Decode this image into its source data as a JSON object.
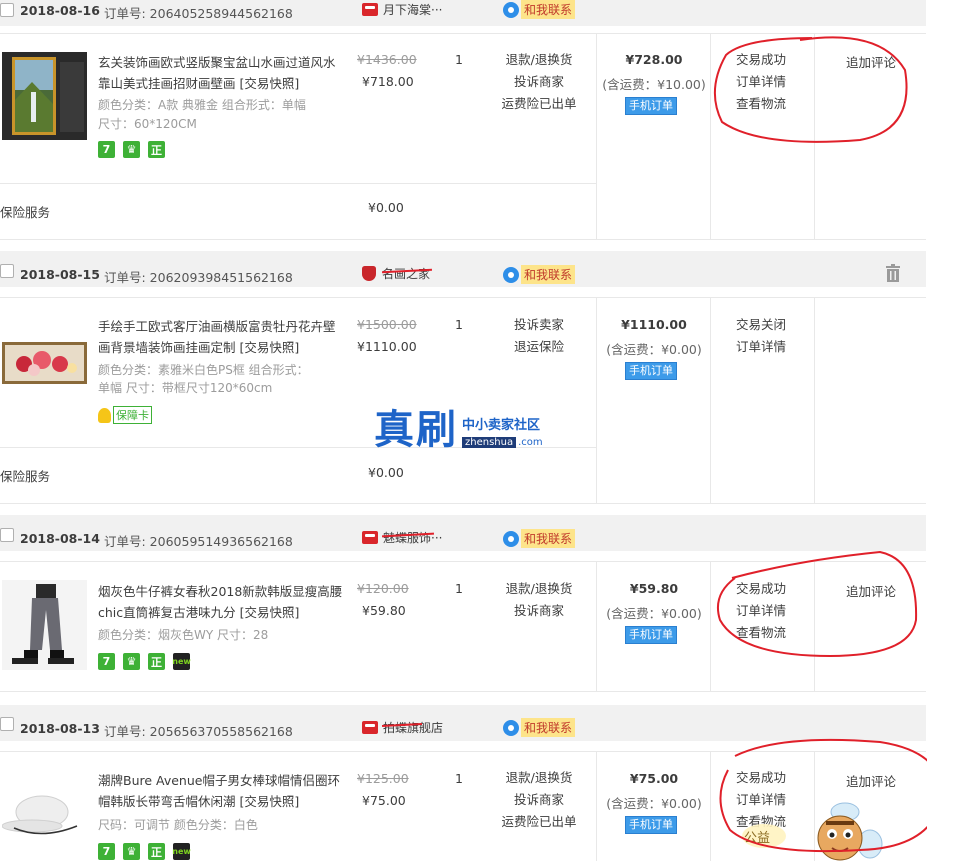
{
  "orders": [
    {
      "date": "2018-08-16",
      "order_label": "订单号: 206405258944562168",
      "shop": "月下海棠···",
      "contact": "和我联系",
      "title": "玄关装饰画欧式竖版聚宝盆山水画过道风水靠山美式挂画招财画壁画 [交易快照]",
      "sku_lines": [
        "颜色分类：A款 典雅金  组合形式：单幅",
        "尺寸：60*120CM"
      ],
      "orig_price": "¥1436.00",
      "price": "¥718.00",
      "qty": "1",
      "services": [
        "退款/退换货",
        "投诉商家",
        "运费险已出单"
      ],
      "total": "¥728.00",
      "shipping": "(含运费：¥10.00)",
      "mobile": "手机订单",
      "status": [
        "交易成功",
        "订单详情",
        "查看物流"
      ],
      "review": "追加评论",
      "insurance_label": "保险服务",
      "insurance_value": "¥0.00"
    },
    {
      "date": "2018-08-15",
      "order_label": "订单号: 206209398451562168",
      "shop": "名画之家",
      "contact": "和我联系",
      "title": "手绘手工欧式客厅油画横版富贵牡丹花卉壁画背景墙装饰画挂画定制 [交易快照]",
      "sku_lines": [
        "颜色分类：素雅米白色PS框  组合形式：",
        "单幅  尺寸：带框尺寸120*60cm"
      ],
      "baoka": "保障卡",
      "orig_price": "¥1500.00",
      "price": "¥1110.00",
      "qty": "1",
      "services": [
        "投诉卖家",
        "退运保险"
      ],
      "total": "¥1110.00",
      "shipping": "(含运费：¥0.00)",
      "mobile": "手机订单",
      "status": [
        "交易关闭",
        "订单详情"
      ],
      "insurance_label": "保险服务",
      "insurance_value": "¥0.00"
    },
    {
      "date": "2018-08-14",
      "order_label": "订单号: 206059514936562168",
      "shop": "魅蝶服饰···",
      "contact": "和我联系",
      "title": "烟灰色牛仔裤女春秋2018新款韩版显瘦高腰chic直筒裤复古港味九分 [交易快照]",
      "sku_lines": [
        "颜色分类：烟灰色WY  尺寸：28"
      ],
      "orig_price": "¥120.00",
      "price": "¥59.80",
      "qty": "1",
      "services": [
        "退款/退换货",
        "投诉商家"
      ],
      "total": "¥59.80",
      "shipping": "(含运费：¥0.00)",
      "mobile": "手机订单",
      "status": [
        "交易成功",
        "订单详情",
        "查看物流"
      ],
      "review": "追加评论"
    },
    {
      "date": "2018-08-13",
      "order_label": "订单号: 205656370558562168",
      "shop": "拍蝶旗舰店",
      "contact": "和我联系",
      "title": "潮牌Bure Avenue帽子男女棒球帽情侣圈环帽韩版长带弯舌帽休闲潮 [交易快照]",
      "sku_lines": [
        "尺码：可调节  颜色分类：白色"
      ],
      "orig_price": "¥125.00",
      "price": "¥75.00",
      "qty": "1",
      "services": [
        "退款/退换货",
        "投诉商家",
        "运费险已出单"
      ],
      "total": "¥75.00",
      "shipping": "(含运费：¥0.00)",
      "mobile": "手机订单",
      "status": [
        "交易成功",
        "订单详情",
        "查看物流"
      ],
      "review": "追加评论"
    }
  ],
  "badges": {
    "seven": "7",
    "zheng": "正",
    "new": "new"
  },
  "watermark": {
    "big": "真刷",
    "cn": "中小卖家社区",
    "en": "zhenshua",
    "com": ".com"
  },
  "sticker": "公益"
}
